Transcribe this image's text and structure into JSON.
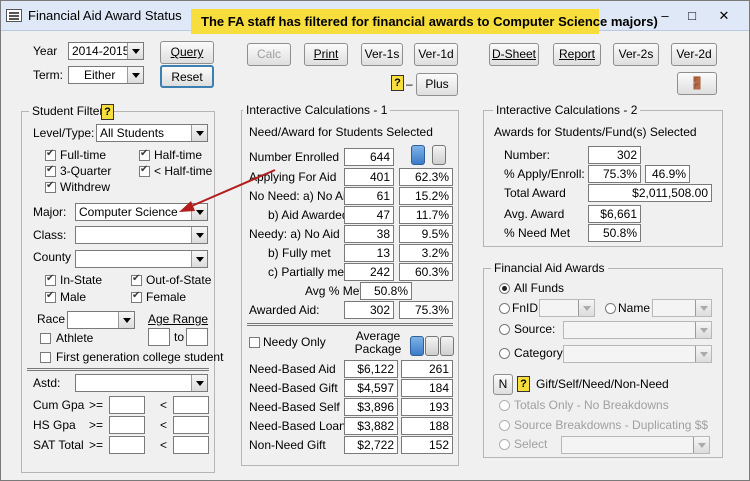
{
  "window": {
    "title": "Financial Aid Award Status",
    "banner": "The FA staff has filtered for financial awards to Computer Science majors)"
  },
  "top": {
    "year_label": "Year",
    "year_value": "2014-2015",
    "term_label": "Term:",
    "term_value": "Either",
    "query": "Query",
    "reset": "Reset",
    "calc": "Calc",
    "print": "Print",
    "ver1s": "Ver-1s",
    "ver1d": "Ver-1d",
    "dsheet": "D-Sheet",
    "report": "Report",
    "ver2s": "Ver-2s",
    "ver2d": "Ver-2d",
    "plus": "Plus"
  },
  "filter": {
    "title": "Student Filter",
    "level_label": "Level/Type:",
    "level_value": "All Students",
    "fulltime": "Full-time",
    "halftime": "Half-time",
    "threequarter": "3-Quarter",
    "lthalftime": "< Half-time",
    "withdrew": "Withdrew",
    "major_label": "Major:",
    "major_value": "Computer Science",
    "class_label": "Class:",
    "county_label": "County",
    "instate": "In-State",
    "outofstate": "Out-of-State",
    "male": "Male",
    "female": "Female",
    "race_label": "Race",
    "age_range_label": "Age Range",
    "to_label": "to",
    "athlete": "Athlete",
    "firstgen": "First generation college student",
    "astd_label": "Astd:",
    "cumgpa": "Cum Gpa",
    "hsgpa": "HS Gpa",
    "sat": "SAT Total",
    "gte": ">=",
    "lt": "<"
  },
  "calc1": {
    "title": "Interactive Calculations - 1",
    "subtitle": "Need/Award for Students Selected",
    "rows": [
      {
        "label": "Number Enrolled",
        "value": "644",
        "pct": ""
      },
      {
        "label": "Applying For Aid",
        "value": "401",
        "pct": "62.3%"
      },
      {
        "label": "No Need: a) No Aid",
        "value": "61",
        "pct": "15.2%"
      },
      {
        "label": "b) Aid Awarded",
        "value": "47",
        "pct": "11.7%"
      },
      {
        "label": "Needy:   a) No Aid",
        "value": "38",
        "pct": "9.5%"
      },
      {
        "label": "b) Fully met",
        "value": "13",
        "pct": "3.2%"
      },
      {
        "label": "c) Partially met",
        "value": "242",
        "pct": "60.3%"
      }
    ],
    "avg_met_label": "Avg % Met",
    "avg_met_value": "50.8%",
    "awarded_label": "Awarded Aid:",
    "awarded_value": "302",
    "awarded_pct": "75.3%",
    "needy_only": "Needy Only",
    "avg_pkg": "Average Package",
    "pkg_rows": [
      {
        "label": "Need-Based Aid",
        "amount": "$6,122",
        "count": "261"
      },
      {
        "label": "Need-Based Gift",
        "amount": "$4,597",
        "count": "184"
      },
      {
        "label": "Need-Based Self",
        "amount": "$3,896",
        "count": "193"
      },
      {
        "label": "Need-Based Loan",
        "amount": "$3,882",
        "count": "188"
      },
      {
        "label": "Non-Need Gift",
        "amount": "$2,722",
        "count": "152"
      }
    ]
  },
  "calc2": {
    "title": "Interactive Calculations - 2",
    "subtitle": "Awards for Students/Fund(s) Selected",
    "number_label": "Number:",
    "number_value": "302",
    "apply_label": "% Apply/Enroll:",
    "apply_a": "75.3%",
    "apply_b": "46.9%",
    "total_label": "Total Award",
    "total_value": "$2,011,508.00",
    "avg_label": "Avg. Award",
    "avg_value": "$6,661",
    "need_label": "% Need Met",
    "need_value": "50.8%"
  },
  "awards": {
    "title": "Financial Aid Awards",
    "allfunds": "All Funds",
    "fnid": "FnID",
    "name": "Name",
    "source": "Source:",
    "category": "Category:",
    "n_btn": "N",
    "gsnn": "Gift/Self/Need/Non-Need",
    "totals_only": "Totals Only - No Breakdowns",
    "source_breakdowns": "Source Breakdowns - Duplicating $$",
    "select": "Select"
  }
}
